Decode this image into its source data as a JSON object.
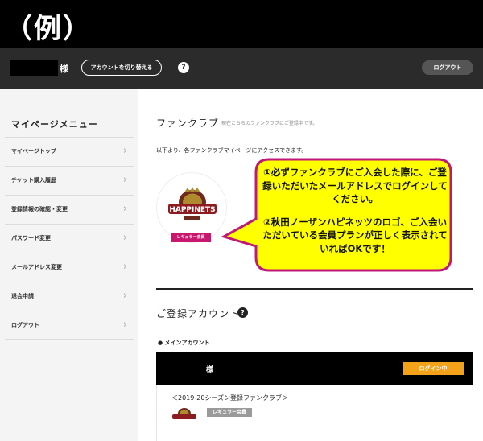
{
  "banner": {
    "label": "（例）"
  },
  "header": {
    "honorific": "様",
    "switch_account_label": "アカウントを切り替える",
    "help_symbol": "?",
    "logout_label": "ログアウト"
  },
  "sidebar": {
    "title": "マイページメニュー",
    "chevron": "›",
    "items": [
      {
        "label": "マイページトップ"
      },
      {
        "label": "チケット購入履歴"
      },
      {
        "label": "登録情報の確認・変更"
      },
      {
        "label": "パスワード変更"
      },
      {
        "label": "メールアドレス変更"
      },
      {
        "label": "退会申請"
      },
      {
        "label": "ログアウト"
      }
    ]
  },
  "main": {
    "title": "ファンクラブ",
    "note": "現在こちらのファンクラブにご登録中です。",
    "access_text": "以下より、各ファンクラブマイページにアクセスできます。",
    "logo_text": "HAPPINETS",
    "membership_badge": "レギュラー会員"
  },
  "callout": {
    "line1": "①必ずファンクラブにご入会した際に、ご登録いただいたメールアドレスでログインしてください。",
    "line2": "②秋田ノーザンハピネッツのロゴ、ご入会いただいている会員プランが正しく表示されていればOKです！"
  },
  "registered": {
    "title": "ご登録アカウント",
    "help_symbol": "?",
    "main_account_label": "● メインアカウント",
    "honorific": "様",
    "login_status": "ログイン中",
    "season_label": "＜2019-20シーズン登録ファンクラブ＞",
    "membership_badge": "レギュラー会員"
  },
  "colors": {
    "topbar": "#2b2b2b",
    "membership_pink": "#c8186e",
    "login_orange": "#f5a21b",
    "callout_fill": "#ffff00",
    "callout_border": "#c0187a"
  }
}
